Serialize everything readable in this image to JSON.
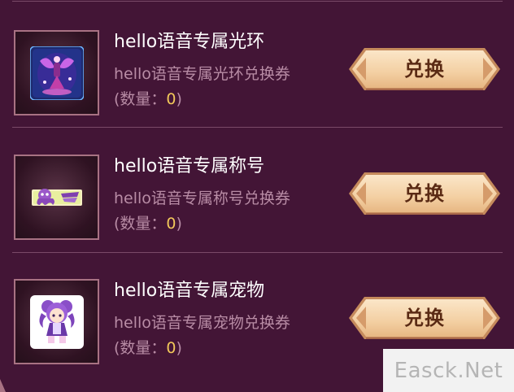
{
  "items": [
    {
      "title": "hello语音专属光环",
      "desc": "hello语音专属光环兑换券",
      "qty_prefix": "(数量：",
      "qty_value": "0",
      "qty_suffix": ")",
      "button_label": "兑换",
      "icon": "halo-icon"
    },
    {
      "title": "hello语音专属称号",
      "desc": "hello语音专属称号兑换券",
      "qty_prefix": "(数量：",
      "qty_value": "0",
      "qty_suffix": ")",
      "button_label": "兑换",
      "icon": "title-badge-icon"
    },
    {
      "title": "hello语音专属宠物",
      "desc": "hello语音专属宠物兑换券",
      "qty_prefix": "(数量：",
      "qty_value": "0",
      "qty_suffix": ")",
      "button_label": "兑换",
      "icon": "pet-icon"
    }
  ],
  "watermark": "Easck.Net",
  "colors": {
    "background": "#431536",
    "title": "#ffffff",
    "desc": "#b88ca5",
    "qty_number": "#f2c85a",
    "button_text": "#5a2a14"
  }
}
